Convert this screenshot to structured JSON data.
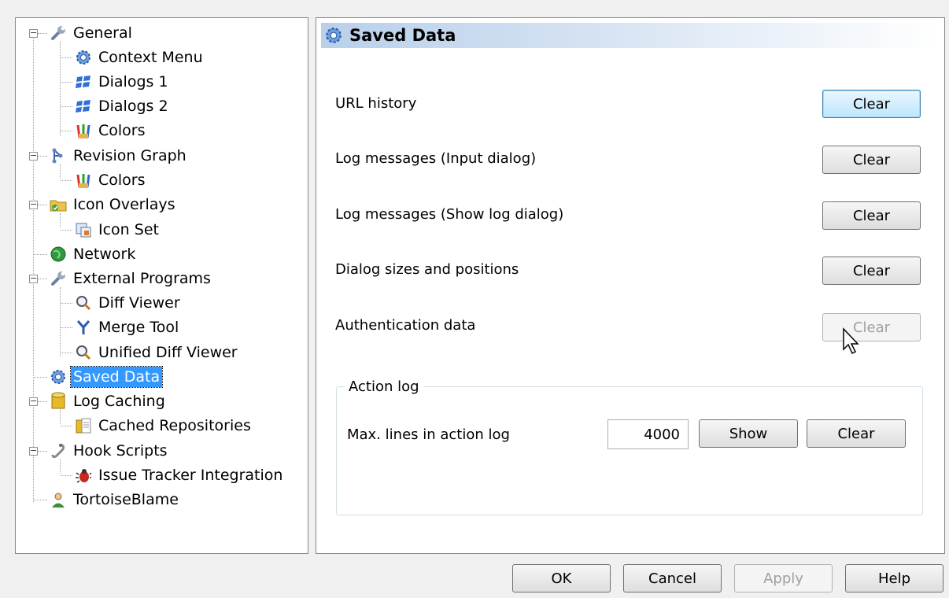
{
  "tree": {
    "items": [
      {
        "label": "General",
        "icon": "wrench-icon"
      },
      {
        "label": "Context Menu",
        "icon": "gear-icon"
      },
      {
        "label": "Dialogs 1",
        "icon": "windows-icon"
      },
      {
        "label": "Dialogs 2",
        "icon": "windows-icon"
      },
      {
        "label": "Colors",
        "icon": "paint-brushes-icon"
      },
      {
        "label": "Revision Graph",
        "icon": "revision-graph-icon"
      },
      {
        "label": "Colors",
        "icon": "paint-brushes-icon"
      },
      {
        "label": "Icon Overlays",
        "icon": "folder-overlay-icon"
      },
      {
        "label": "Icon Set",
        "icon": "icon-set-icon"
      },
      {
        "label": "Network",
        "icon": "globe-icon"
      },
      {
        "label": "External Programs",
        "icon": "wrench-icon"
      },
      {
        "label": "Diff Viewer",
        "icon": "magnifier-icon"
      },
      {
        "label": "Merge Tool",
        "icon": "merge-icon"
      },
      {
        "label": "Unified Diff Viewer",
        "icon": "magnifier-icon"
      },
      {
        "label": "Saved Data",
        "icon": "gear-icon",
        "selected": true
      },
      {
        "label": "Log Caching",
        "icon": "database-icon"
      },
      {
        "label": "Cached Repositories",
        "icon": "cached-repos-icon"
      },
      {
        "label": "Hook Scripts",
        "icon": "hook-icon"
      },
      {
        "label": "Issue Tracker Integration",
        "icon": "bug-icon"
      },
      {
        "label": "TortoiseBlame",
        "icon": "user-icon"
      }
    ]
  },
  "page": {
    "title": "Saved Data",
    "rows": [
      {
        "label": "URL history",
        "button": "Clear",
        "state": "focused"
      },
      {
        "label": "Log messages (Input dialog)",
        "button": "Clear",
        "state": "normal"
      },
      {
        "label": "Log messages (Show log dialog)",
        "button": "Clear",
        "state": "normal"
      },
      {
        "label": "Dialog sizes and positions",
        "button": "Clear",
        "state": "normal"
      },
      {
        "label": "Authentication data",
        "button": "Clear",
        "state": "disabled"
      }
    ],
    "action_log": {
      "title": "Action log",
      "max_lines_label": "Max. lines in action log",
      "max_lines_value": "4000",
      "show_label": "Show",
      "clear_label": "Clear"
    }
  },
  "footer": {
    "ok": "OK",
    "cancel": "Cancel",
    "apply": "Apply",
    "help": "Help"
  }
}
